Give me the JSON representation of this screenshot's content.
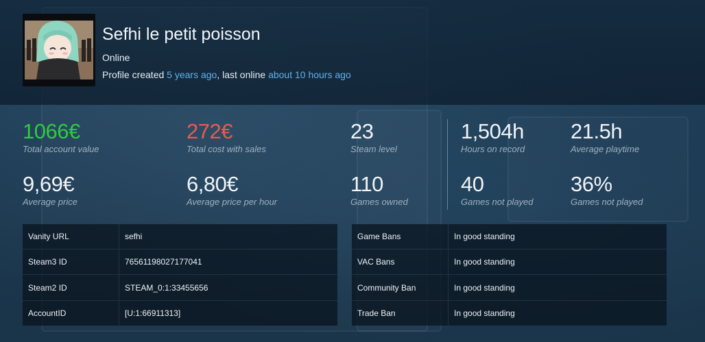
{
  "profile": {
    "name": "Sefhi le petit poisson",
    "status": "Online",
    "created_prefix": "Profile created ",
    "created_ago": "5 years ago",
    "online_prefix": ", last online ",
    "online_ago": "about 10 hours ago"
  },
  "stats": [
    {
      "value": "1066€",
      "label": "Total account value"
    },
    {
      "value": "272€",
      "label": "Total cost with sales"
    },
    {
      "value": "23",
      "label": "Steam level"
    },
    {
      "value": "1,504h",
      "label": "Hours on record"
    },
    {
      "value": "21.5h",
      "label": "Average playtime"
    },
    {
      "value": "9,69€",
      "label": "Average price"
    },
    {
      "value": "6,80€",
      "label": "Average price per hour"
    },
    {
      "value": "110",
      "label": "Games owned"
    },
    {
      "value": "40",
      "label": "Games not played"
    },
    {
      "value": "36%",
      "label": "Games not played"
    }
  ],
  "ids_table": [
    {
      "key": "Vanity URL",
      "value": "sefhi"
    },
    {
      "key": "Steam3 ID",
      "value": "76561198027177041"
    },
    {
      "key": "Steam2 ID",
      "value": "STEAM_0:1:33455656"
    },
    {
      "key": "AccountID",
      "value": "[U:1:66911313]"
    }
  ],
  "bans_table": [
    {
      "key": "Game Bans",
      "value": "In good standing"
    },
    {
      "key": "VAC Bans",
      "value": "In good standing"
    },
    {
      "key": "Community Ban",
      "value": "In good standing"
    },
    {
      "key": "Trade Ban",
      "value": "In good standing"
    }
  ],
  "colors": {
    "positive": "#2ecc40",
    "negative": "#ea5b4e",
    "link": "#5fb1ea"
  }
}
